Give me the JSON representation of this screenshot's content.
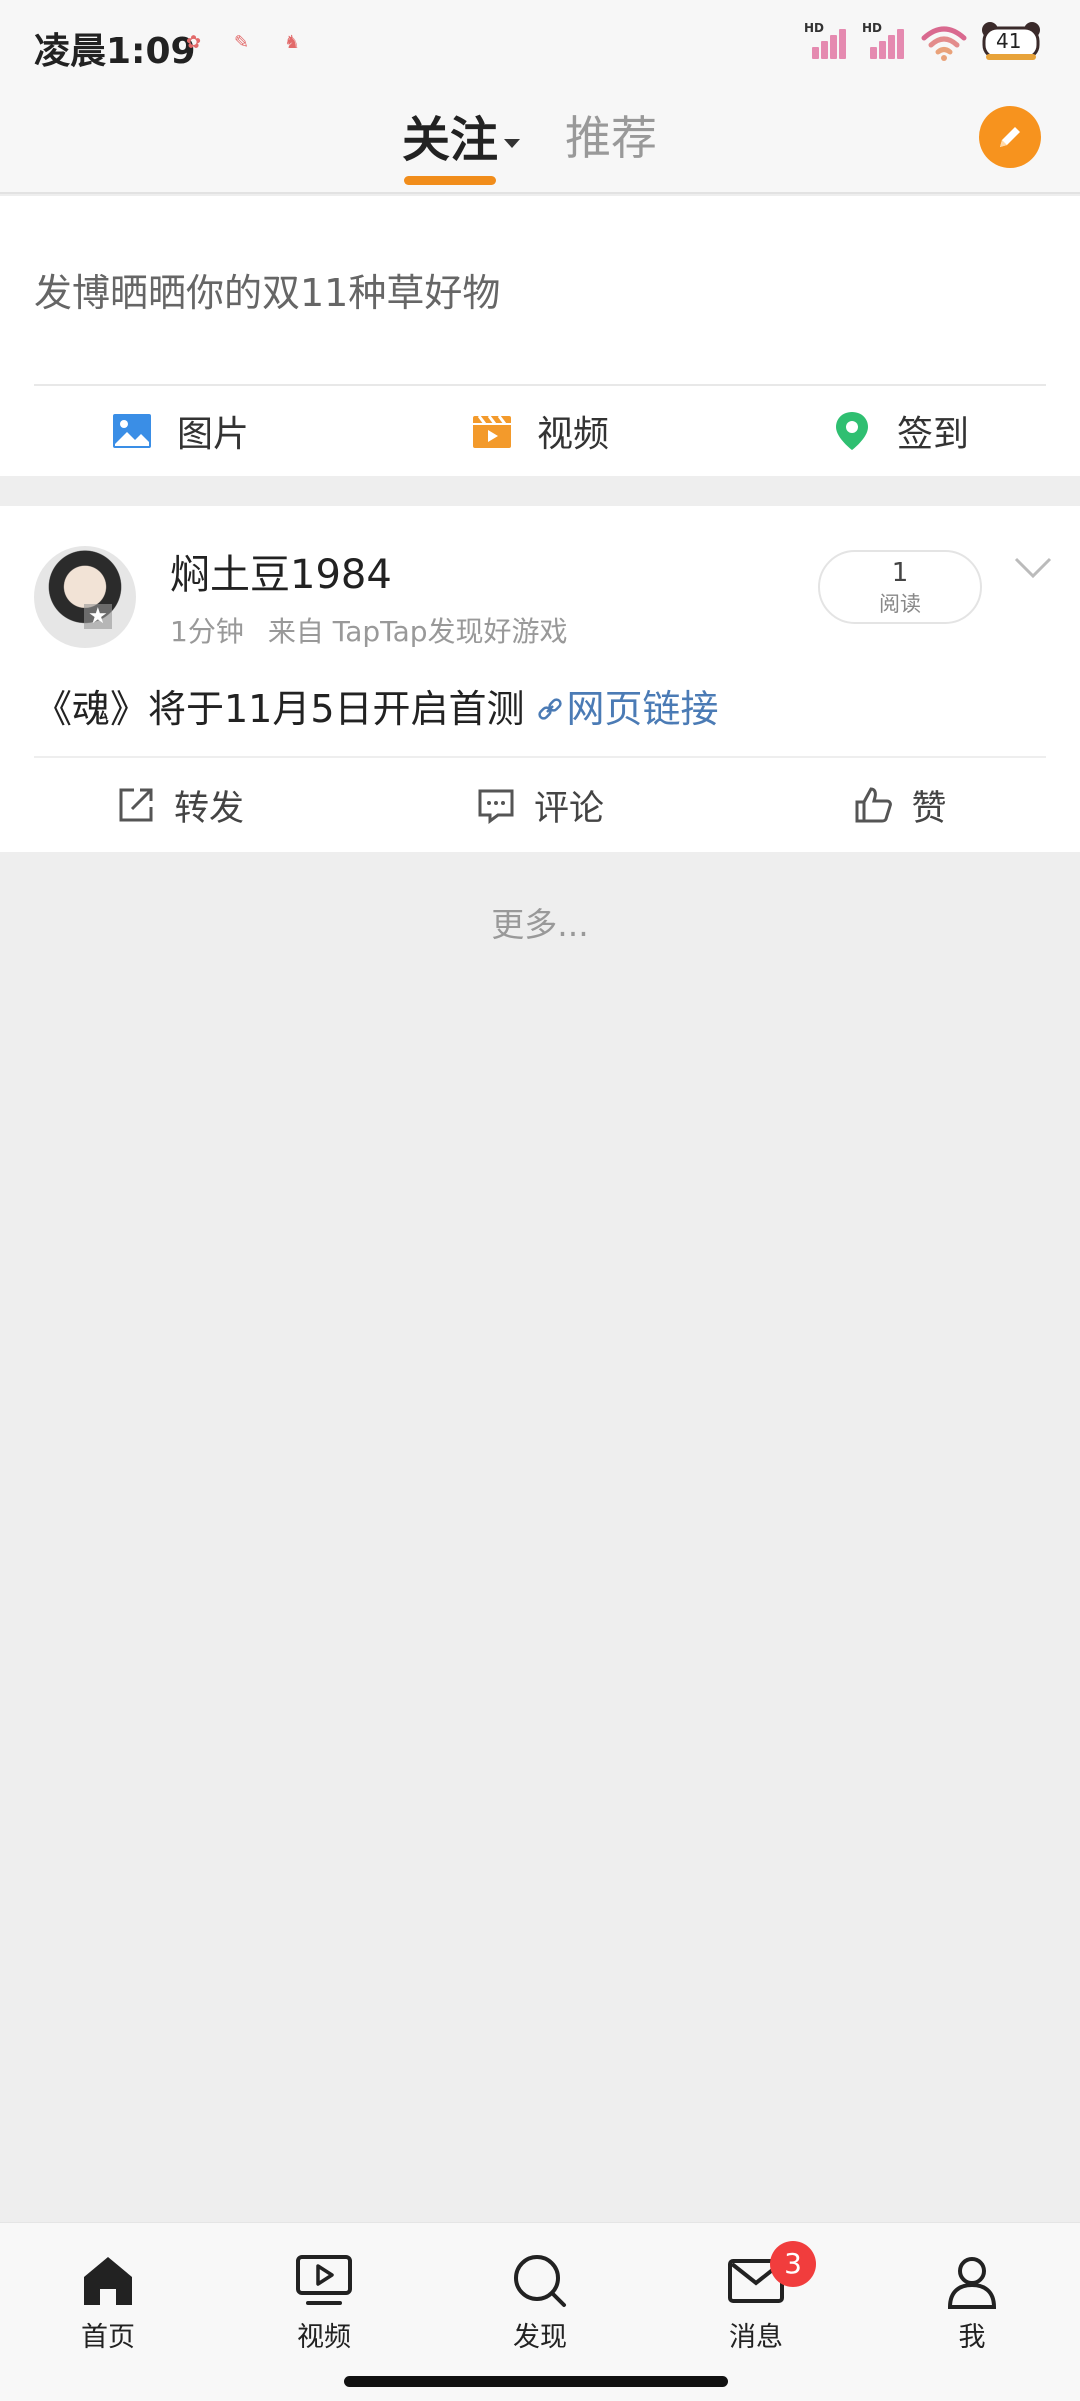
{
  "status": {
    "time": "凌晨1:09",
    "battery": "41",
    "network1": "HD",
    "network2": "HD"
  },
  "topnav": {
    "tab_follow": "关注",
    "tab_recommend": "推荐",
    "compose_icon": "pencil-icon"
  },
  "composer": {
    "placeholder": "发博晒晒你的双11种草好物",
    "actions": [
      {
        "label": "图片",
        "icon": "image-icon",
        "color": "#3a8ee6"
      },
      {
        "label": "视频",
        "icon": "video-clapper-icon",
        "color": "#f39a2b"
      },
      {
        "label": "签到",
        "icon": "location-pin-icon",
        "color": "#2fbf71"
      }
    ]
  },
  "post": {
    "username": "焖土豆1984",
    "time": "1分钟",
    "source": "来自 TapTap发现好游戏",
    "read_count": "1",
    "read_label": "阅读",
    "text": "《魂》将于11月5日开启首测",
    "link_text": "网页链接",
    "actions": [
      {
        "label": "转发",
        "icon": "share-icon"
      },
      {
        "label": "评论",
        "icon": "comment-icon"
      },
      {
        "label": "赞",
        "icon": "thumbs-up-icon"
      }
    ]
  },
  "more_text": "更多...",
  "bottomnav": {
    "items": [
      {
        "label": "首页",
        "icon": "home-icon"
      },
      {
        "label": "视频",
        "icon": "video-play-icon"
      },
      {
        "label": "发现",
        "icon": "search-icon"
      },
      {
        "label": "消息",
        "icon": "mail-icon",
        "badge": "3"
      },
      {
        "label": "我",
        "icon": "profile-icon"
      }
    ]
  },
  "colors": {
    "accent": "#f18d1b",
    "link": "#4b7bb5",
    "badge": "#f13d3d"
  }
}
